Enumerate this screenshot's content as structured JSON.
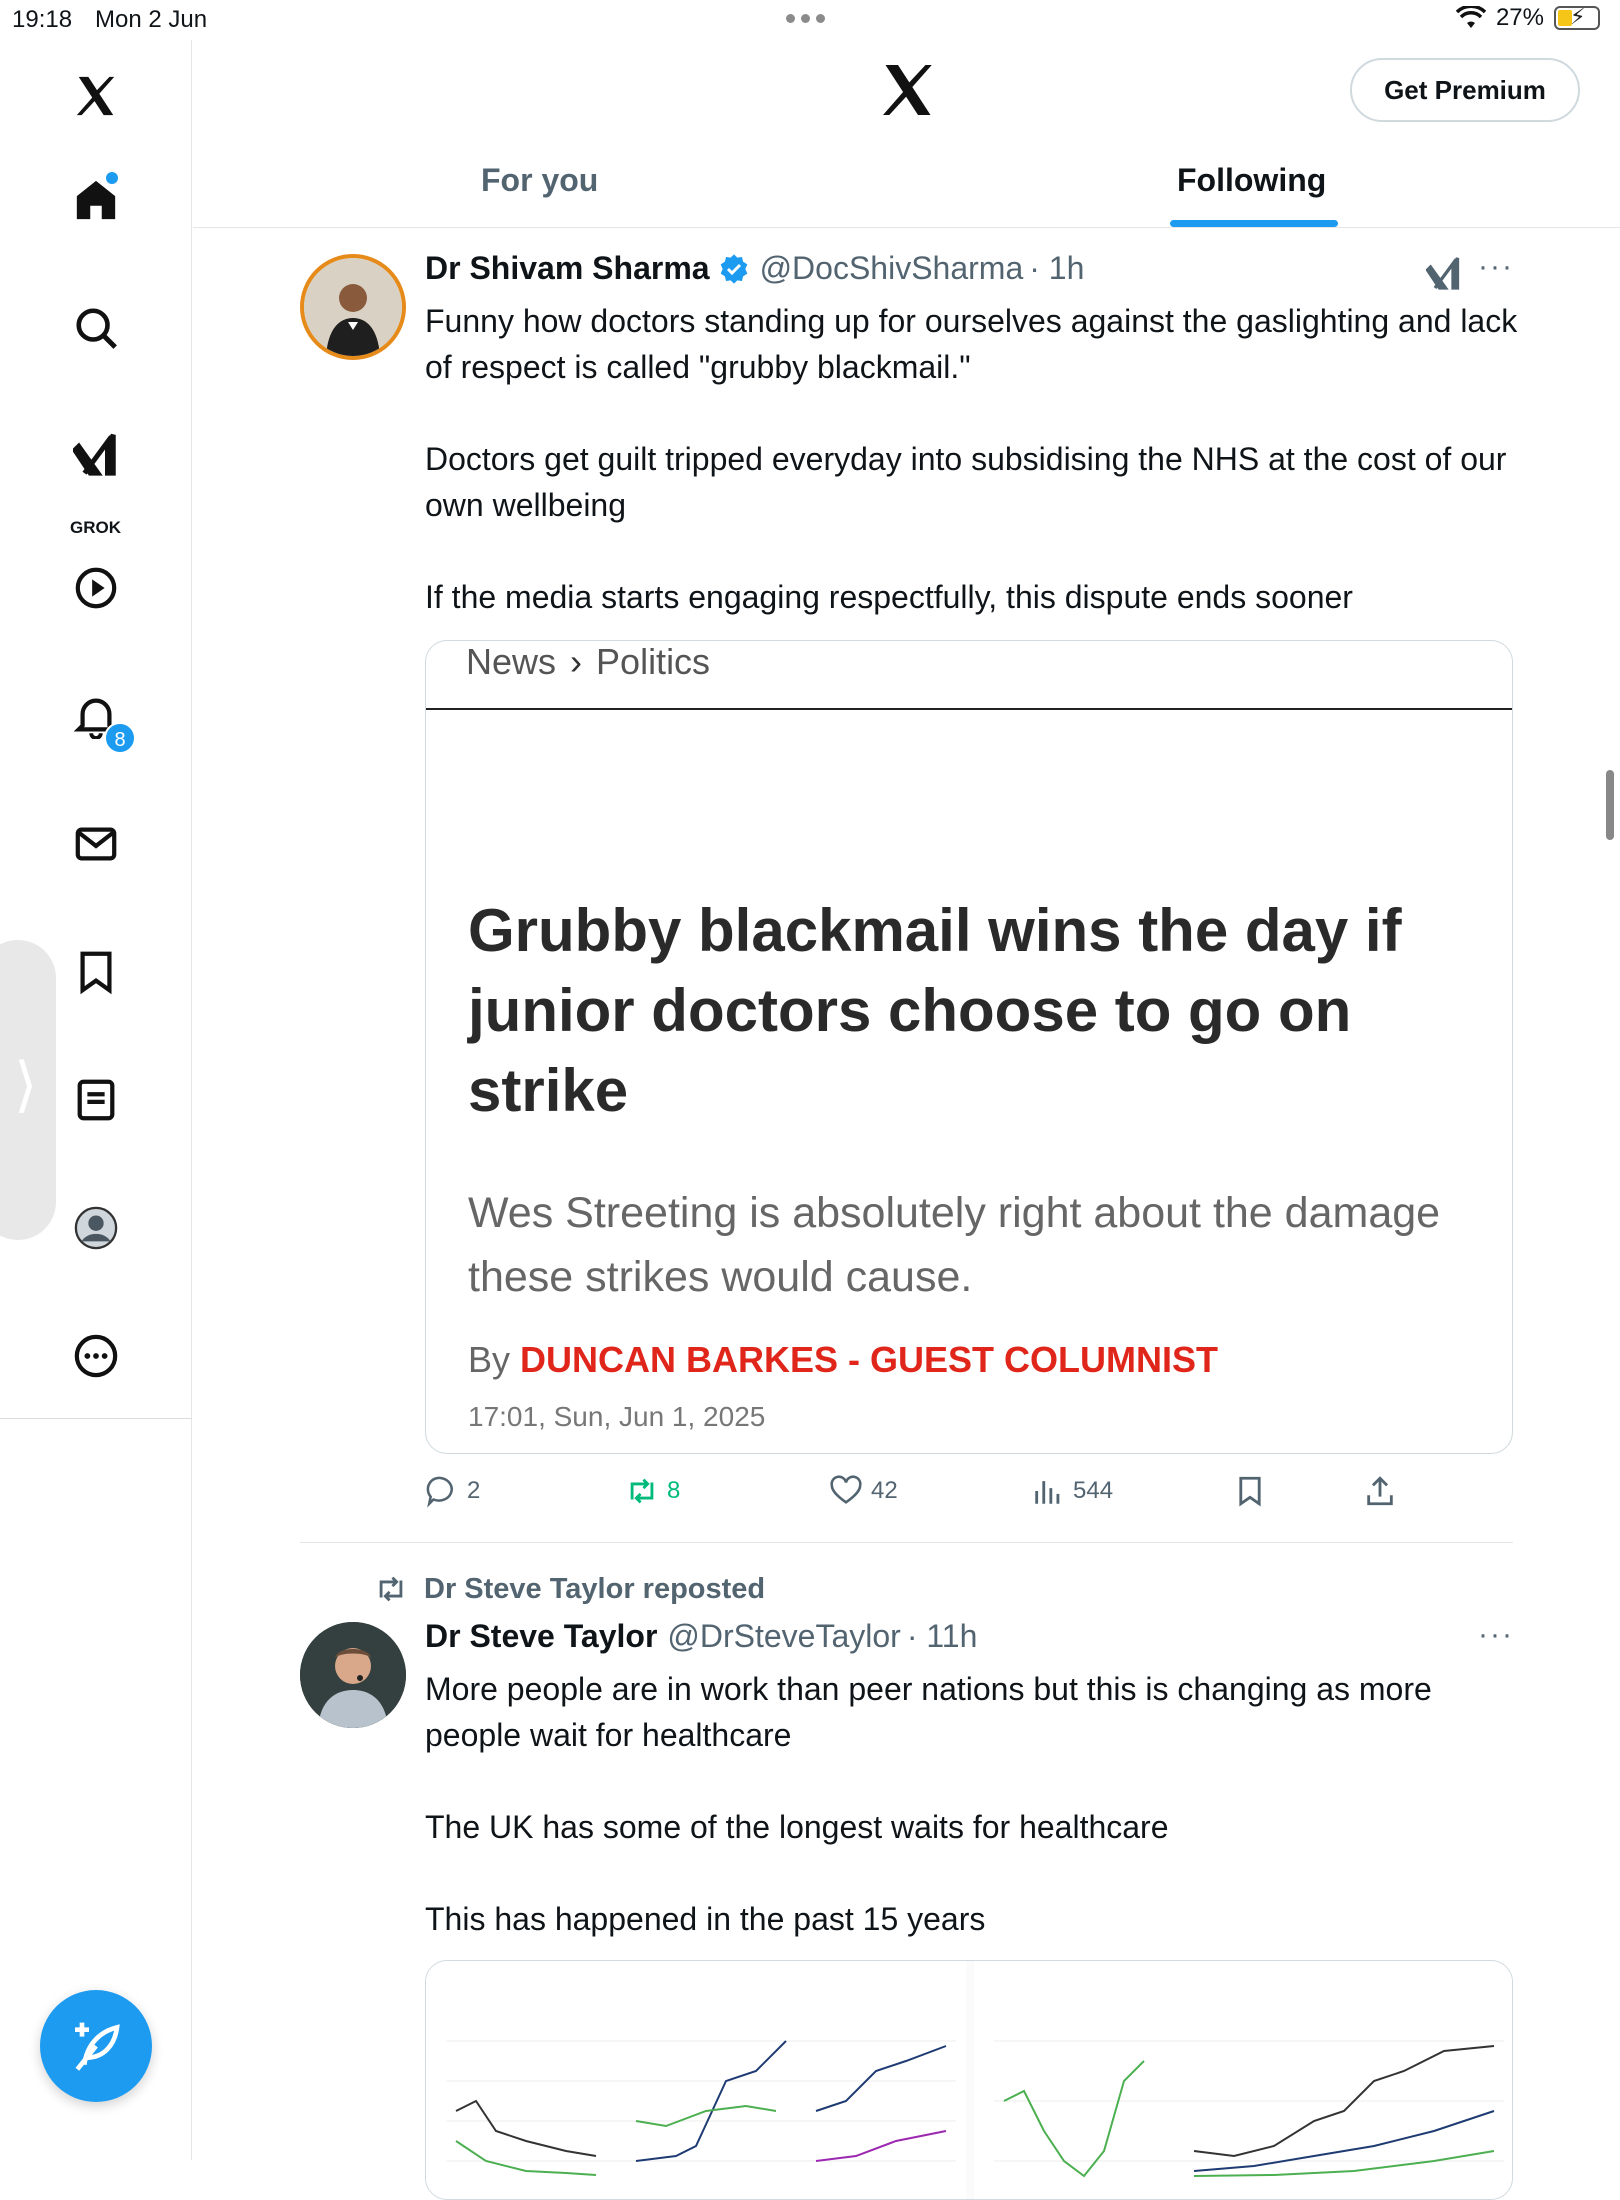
{
  "status_bar": {
    "time": "19:18",
    "date": "Mon 2 Jun",
    "battery": "27%"
  },
  "sidebar": {
    "grok_label": "GROK",
    "notification_count": "8",
    "items": [
      "home-icon",
      "search-icon",
      "grok-icon",
      "video-icon",
      "bell-icon",
      "mail-icon",
      "bookmark-icon",
      "article-icon",
      "profile-icon",
      "more-icon"
    ]
  },
  "header": {
    "premium_label": "Get Premium"
  },
  "tabs": [
    {
      "label": "For you",
      "active": false
    },
    {
      "label": "Following",
      "active": true
    }
  ],
  "colors": {
    "accent": "#1d9bf0",
    "retweet": "#00ba7c",
    "byline_red": "#e0261b"
  },
  "tweets": [
    {
      "name": "Dr Shivam Sharma",
      "handle": "@DocShivSharma",
      "time": "· 1h",
      "verified": true,
      "paragraphs": [
        "Funny how doctors standing up for ourselves against the gaslighting and lack of respect is called \"grubby blackmail.\"",
        "Doctors get guilt tripped everyday into subsidising the NHS at the cost of our own wellbeing",
        "If the media starts engaging respectfully, this dispute ends sooner"
      ],
      "card": {
        "crumb_1": "News",
        "crumb_2": "Politics",
        "headline": "Grubby blackmail wins the day if junior doctors choose to go on strike",
        "standfirst": "Wes Streeting is absolutely right about the damage these strikes would cause.",
        "by": "By ",
        "author": "DUNCAN BARKES - GUEST COLUMNIST",
        "date": "17:01, Sun, Jun 1, 2025"
      },
      "stats": {
        "replies": "2",
        "reposts": "8",
        "likes": "42",
        "views": "544"
      }
    },
    {
      "reposted_by": "Dr Steve Taylor reposted",
      "name": "Dr Steve Taylor",
      "handle": "@DrSteveTaylor",
      "time": "· 11h",
      "paragraphs": [
        "More people are in work than peer nations but this is changing as more people wait for healthcare",
        "The UK has some of the longest waits for healthcare",
        "This has happened in the past 15 years"
      ]
    }
  ]
}
